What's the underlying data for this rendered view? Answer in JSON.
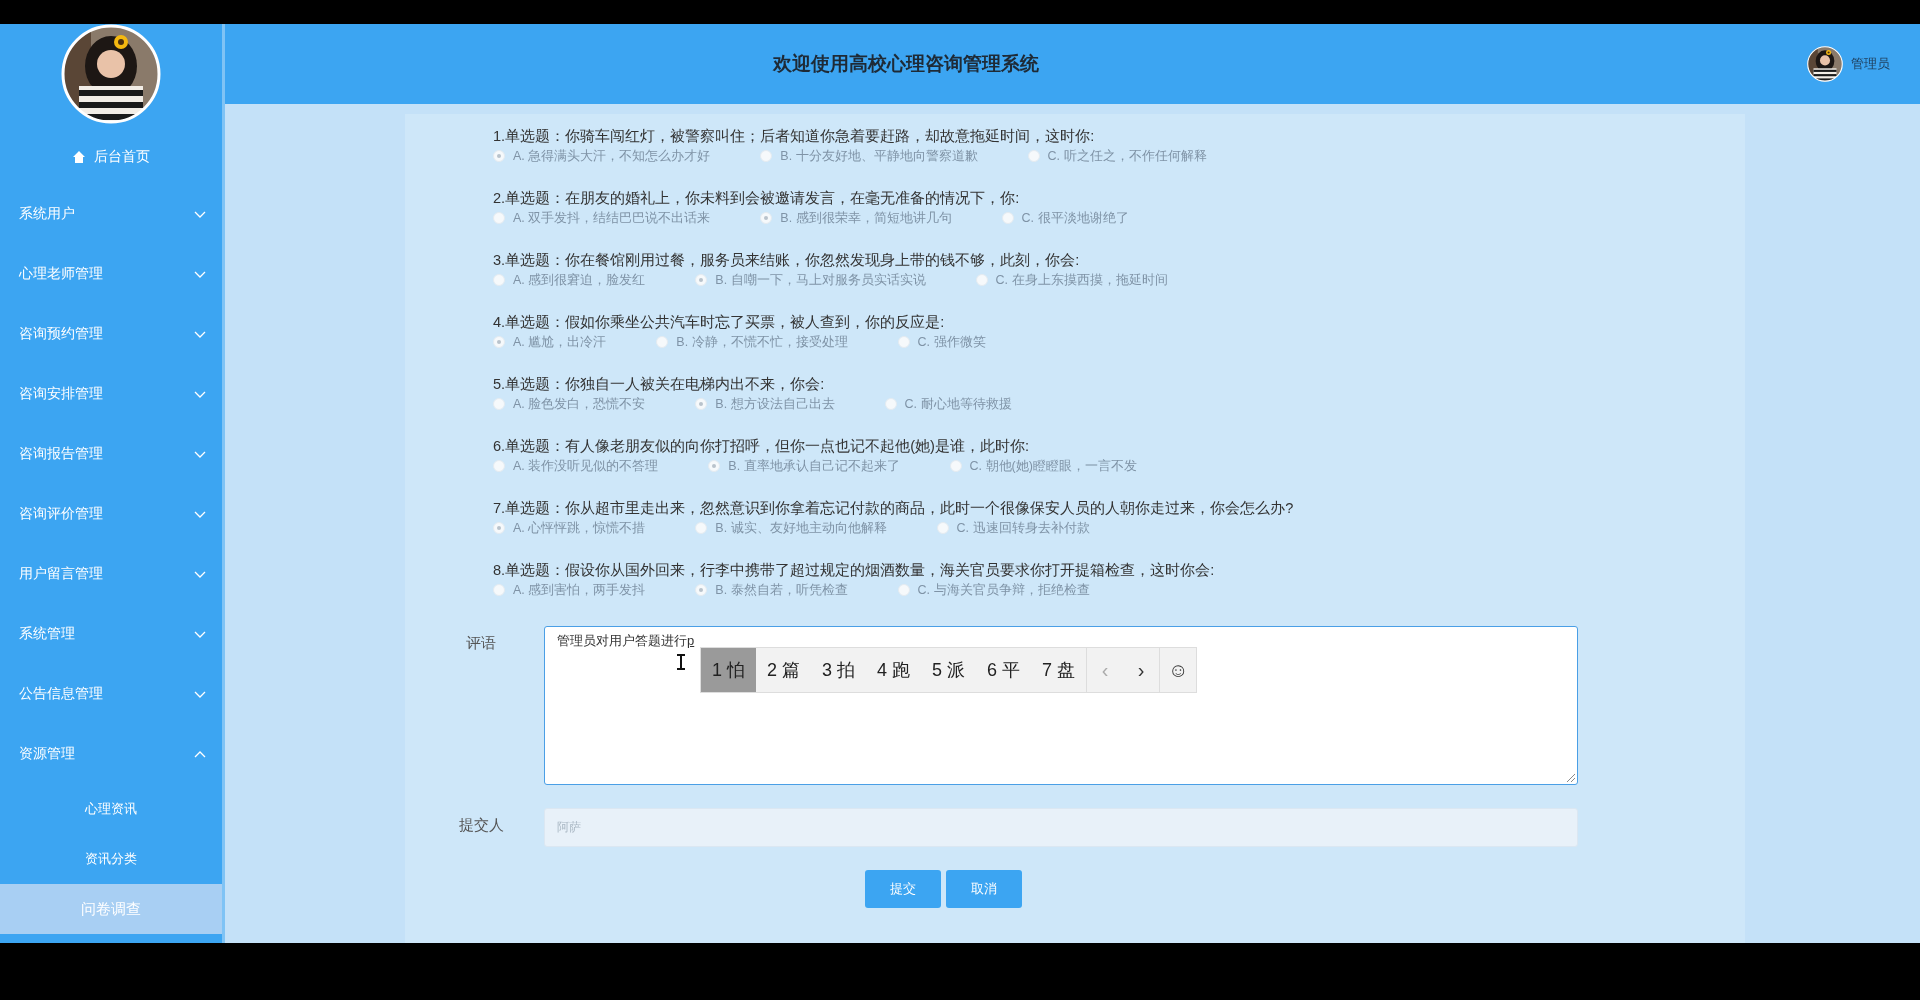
{
  "sidebar": {
    "home": "后台首页",
    "menu": [
      {
        "label": "系统用户",
        "expanded": false
      },
      {
        "label": "心理老师管理",
        "expanded": false
      },
      {
        "label": "咨询预约管理",
        "expanded": false
      },
      {
        "label": "咨询安排管理",
        "expanded": false
      },
      {
        "label": "咨询报告管理",
        "expanded": false
      },
      {
        "label": "咨询评价管理",
        "expanded": false
      },
      {
        "label": "用户留言管理",
        "expanded": false
      },
      {
        "label": "系统管理",
        "expanded": false
      },
      {
        "label": "公告信息管理",
        "expanded": false
      },
      {
        "label": "资源管理",
        "expanded": true,
        "children": [
          {
            "label": "心理资讯",
            "selected": false
          },
          {
            "label": "资讯分类",
            "selected": false
          },
          {
            "label": "问卷调查",
            "selected": true
          }
        ]
      }
    ]
  },
  "header": {
    "title": "欢迎使用高校心理咨询管理系统",
    "user": "管理员"
  },
  "questions": [
    {
      "title": "1.单选题：你骑车闯红灯，被警察叫住；后者知道你急着要赶路，却故意拖延时间，这时你:",
      "disabled": true,
      "options": [
        {
          "label": "A. 急得满头大汗，不知怎么办才好",
          "selected": true
        },
        {
          "label": "B. 十分友好地、平静地向警察道歉",
          "selected": false
        },
        {
          "label": "C. 听之任之，不作任何解释",
          "selected": false
        }
      ]
    },
    {
      "title": "2.单选题：在朋友的婚礼上，你未料到会被邀请发言，在毫无准备的情况下，你:",
      "disabled": true,
      "options": [
        {
          "label": "A. 双手发抖，结结巴巴说不出话来",
          "selected": false
        },
        {
          "label": "B. 感到很荣幸，简短地讲几句",
          "selected": true
        },
        {
          "label": "C. 很平淡地谢绝了",
          "selected": false
        }
      ]
    },
    {
      "title": "3.单选题：你在餐馆刚用过餐，服务员来结账，你忽然发现身上带的钱不够，此刻，你会:",
      "disabled": true,
      "options": [
        {
          "label": "A. 感到很窘迫，脸发红",
          "selected": false
        },
        {
          "label": "B. 自嘲一下，马上对服务员实话实说",
          "selected": true
        },
        {
          "label": "C. 在身上东摸西摸，拖延时间",
          "selected": false
        }
      ]
    },
    {
      "title": "4.单选题：假如你乘坐公共汽车时忘了买票，被人查到，你的反应是:",
      "disabled": true,
      "options": [
        {
          "label": "A. 尴尬，出冷汗",
          "selected": true
        },
        {
          "label": "B. 冷静，不慌不忙，接受处理",
          "selected": false
        },
        {
          "label": "C. 强作微笑",
          "selected": false
        }
      ]
    },
    {
      "title": "5.单选题：你独自一人被关在电梯内出不来，你会:",
      "disabled": true,
      "options": [
        {
          "label": "A. 脸色发白，恐慌不安",
          "selected": false
        },
        {
          "label": "B. 想方设法自己出去",
          "selected": true
        },
        {
          "label": "C. 耐心地等待救援",
          "selected": false
        }
      ]
    },
    {
      "title": "6.单选题：有人像老朋友似的向你打招呼，但你一点也记不起他(她)是谁，此时你:",
      "disabled": true,
      "options": [
        {
          "label": "A. 装作没听见似的不答理",
          "selected": false
        },
        {
          "label": "B. 直率地承认自己记不起来了",
          "selected": true
        },
        {
          "label": "C. 朝他(她)瞪瞪眼，一言不发",
          "selected": false
        }
      ]
    },
    {
      "title": "7.单选题：你从超市里走出来，忽然意识到你拿着忘记付款的商品，此时一个很像保安人员的人朝你走过来，你会怎么办?",
      "disabled": true,
      "options": [
        {
          "label": "A. 心怦怦跳，惊慌不措",
          "selected": true
        },
        {
          "label": "B. 诚实、友好地主动向他解释",
          "selected": false
        },
        {
          "label": "C. 迅速回转身去补付款",
          "selected": false
        }
      ]
    },
    {
      "title": "8.单选题：假设你从国外回来，行李中携带了超过规定的烟酒数量，海关官员要求你打开提箱检查，这时你会:",
      "disabled": true,
      "options": [
        {
          "label": "A. 感到害怕，两手发抖",
          "selected": false
        },
        {
          "label": "B. 泰然自若，听凭检查",
          "selected": true
        },
        {
          "label": "C. 与海关官员争辩，拒绝检查",
          "selected": false
        }
      ]
    }
  ],
  "form": {
    "comment": {
      "label": "评语",
      "value": "管理员对用户答题进行",
      "composing": "p"
    },
    "ime": {
      "candidates": [
        {
          "label": "1 怕",
          "selected": true
        },
        {
          "label": "2 篇",
          "selected": false
        },
        {
          "label": "3 拍",
          "selected": false
        },
        {
          "label": "4 跑",
          "selected": false
        },
        {
          "label": "5 派",
          "selected": false
        },
        {
          "label": "6 平",
          "selected": false
        },
        {
          "label": "7 盘",
          "selected": false
        }
      ],
      "prev": "‹",
      "next": "›",
      "emoji": "☺"
    },
    "submitter": {
      "label": "提交人",
      "value": "阿萨",
      "disabled": true
    },
    "buttons": [
      "提交",
      "取消"
    ]
  }
}
